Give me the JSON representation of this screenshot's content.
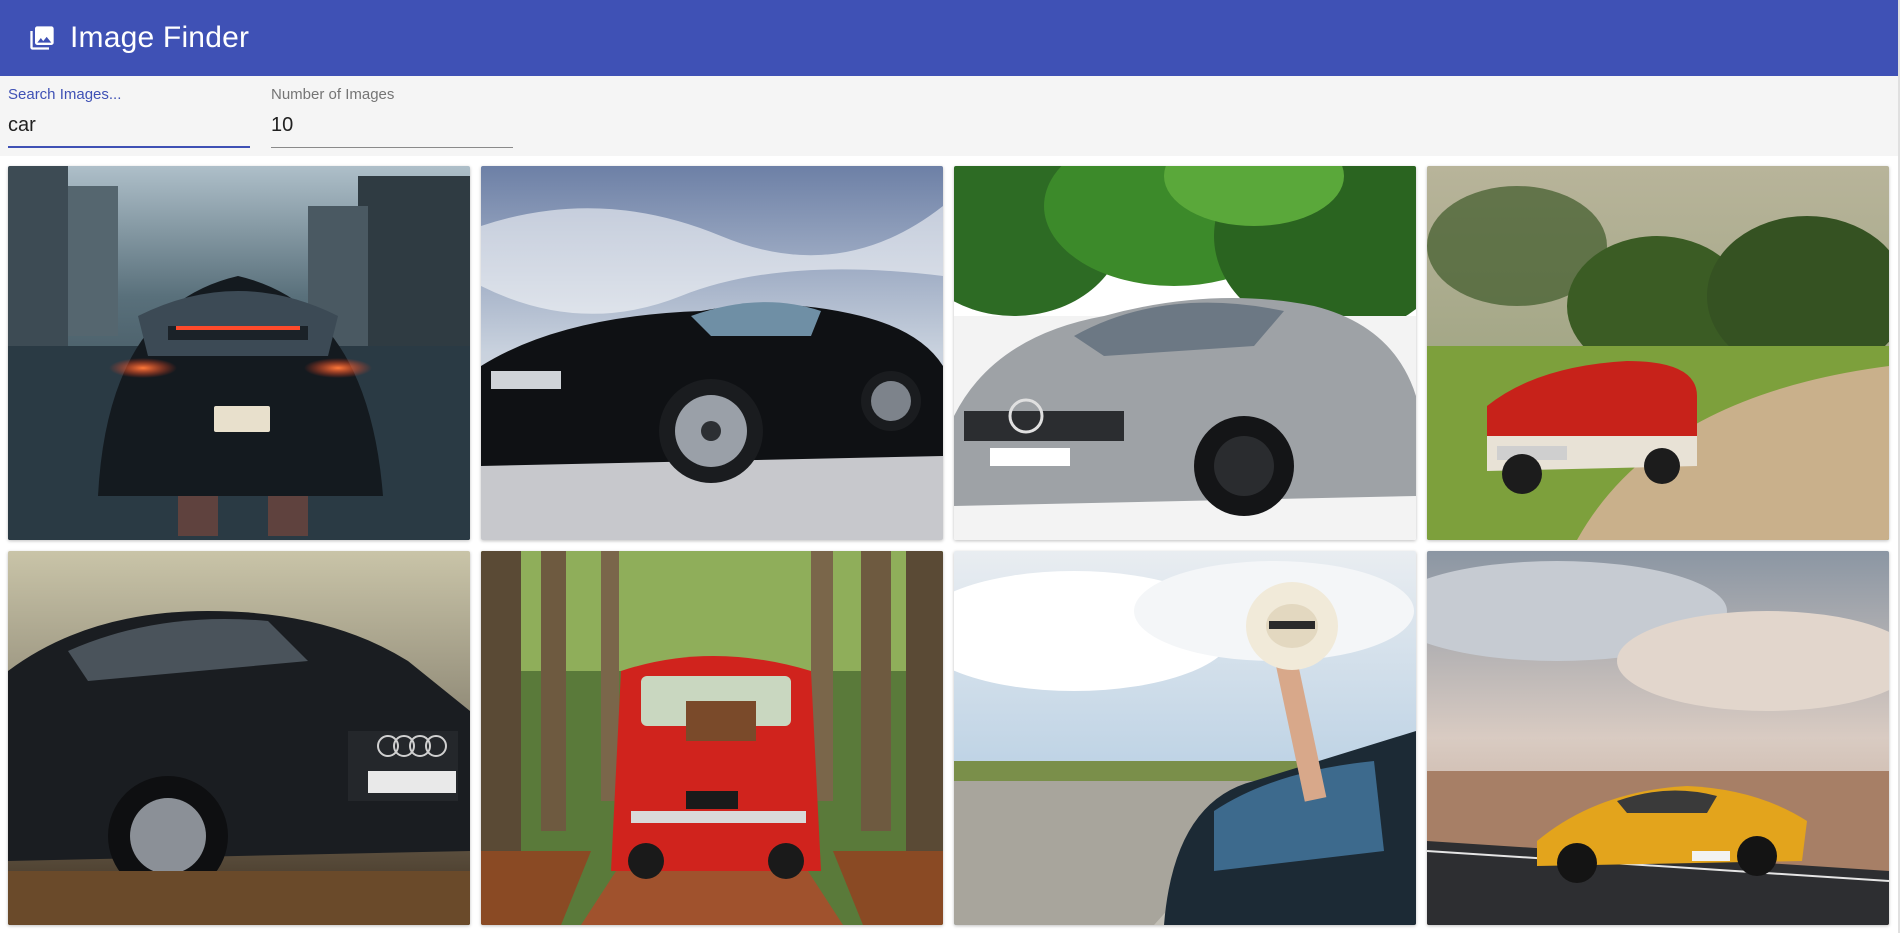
{
  "app": {
    "title": "Image Finder",
    "logo_icon": "image-icon",
    "brand_color": "#3f51b5"
  },
  "search": {
    "label": "Search Images...",
    "value": "car"
  },
  "count": {
    "label": "Number of Images",
    "value": "10"
  },
  "images": [
    {
      "name": "porsche-rear-rainy-street",
      "alt": "Black Porsche rear view on wet city street"
    },
    {
      "name": "black-mustang",
      "alt": "Black Mustang under dramatic sky"
    },
    {
      "name": "silver-amg",
      "alt": "Silver Mercedes AMG in front of trees"
    },
    {
      "name": "red-vintage-convertible",
      "alt": "Red vintage convertible on dirt road"
    },
    {
      "name": "black-audi",
      "alt": "Black Audi front three-quarter view"
    },
    {
      "name": "red-fiat-forest",
      "alt": "Red Fiat 500 on forest road"
    },
    {
      "name": "hat-out-of-car-window",
      "alt": "Hand holding hat out of car window"
    },
    {
      "name": "yellow-lamborghini-desert",
      "alt": "Yellow Lamborghini on desert road"
    }
  ],
  "colors": {
    "appbar": "#3f51b5",
    "controls_bg": "#f5f5f5"
  }
}
